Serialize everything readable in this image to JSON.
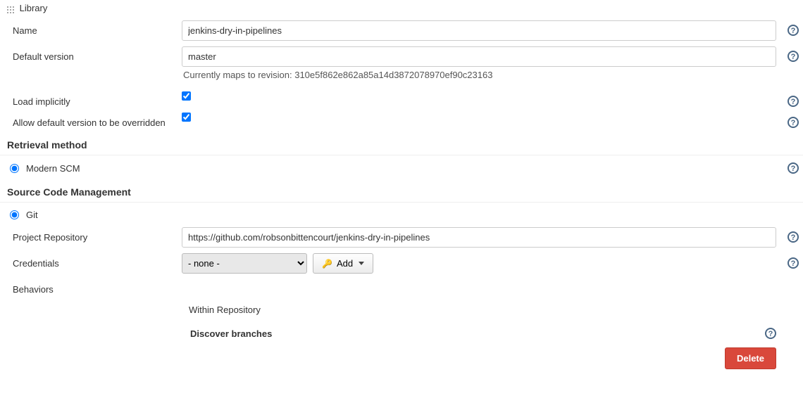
{
  "library": {
    "title": "Library",
    "name_label": "Name",
    "name_value": "jenkins-dry-in-pipelines",
    "default_version_label": "Default version",
    "default_version_value": "master",
    "revision_text": "Currently maps to revision: 310e5f862e862a85a14d3872078970ef90c23163",
    "load_implicitly_label": "Load implicitly",
    "allow_override_label": "Allow default version to be overridden"
  },
  "retrieval": {
    "header": "Retrieval method",
    "modern_scm_label": "Modern SCM"
  },
  "scm": {
    "header": "Source Code Management",
    "git_label": "Git",
    "repo_label": "Project Repository",
    "repo_value": "https://github.com/robsonbittencourt/jenkins-dry-in-pipelines",
    "credentials_label": "Credentials",
    "credentials_selected": "- none -",
    "add_label": "Add",
    "behaviors_label": "Behaviors",
    "within_repo_label": "Within Repository",
    "discover_label": "Discover branches",
    "delete_label": "Delete"
  }
}
